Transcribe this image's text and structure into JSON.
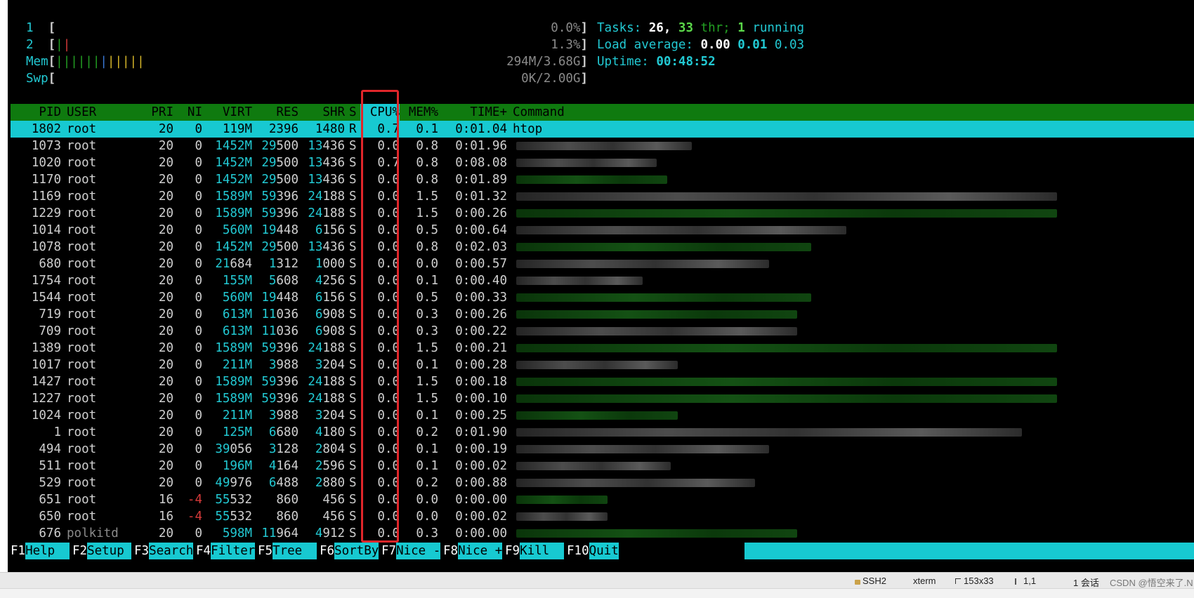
{
  "meters": {
    "cpu1": {
      "label": "1",
      "value": "0.0%"
    },
    "cpu2": {
      "label": "2",
      "value": "1.3%"
    },
    "mem": {
      "label": "Mem",
      "value": "294M/3.68G"
    },
    "swp": {
      "label": "Swp",
      "value": "0K/2.00G"
    }
  },
  "stats": {
    "tasks_label": "Tasks:",
    "tasks": "26,",
    "thr": "33",
    "thr_label": "thr;",
    "running": "1",
    "running_label": "running",
    "load_label": "Load average:",
    "load1": "0.00",
    "load5": "0.01",
    "load15": "0.03",
    "uptime_label": "Uptime:",
    "uptime": "00:48:52"
  },
  "columns": {
    "pid": "PID",
    "user": "USER",
    "pri": "PRI",
    "ni": "NI",
    "virt": "VIRT",
    "res": "RES",
    "shr": "SHR",
    "s": "S",
    "cpu": "CPU%",
    "mem": "MEM%",
    "time": "TIME+",
    "cmd": "Command"
  },
  "processes": [
    {
      "pid": "1802",
      "user": "root",
      "pri": "20",
      "ni": "0",
      "virt": "119M",
      "res": "2396",
      "shr": "1480",
      "s": "R",
      "cpu": "0.7",
      "mem": "0.1",
      "time": "0:01.04",
      "cmd": "htop"
    },
    {
      "pid": "1073",
      "user": "root",
      "pri": "20",
      "ni": "0",
      "virt": "1452M",
      "res": "29500",
      "shr": "13436",
      "s": "S",
      "cpu": "0.0",
      "mem": "0.8",
      "time": "0:01.96"
    },
    {
      "pid": "1020",
      "user": "root",
      "pri": "20",
      "ni": "0",
      "virt": "1452M",
      "res": "29500",
      "shr": "13436",
      "s": "S",
      "cpu": "0.7",
      "mem": "0.8",
      "time": "0:08.08"
    },
    {
      "pid": "1170",
      "user": "root",
      "pri": "20",
      "ni": "0",
      "virt": "1452M",
      "res": "29500",
      "shr": "13436",
      "s": "S",
      "cpu": "0.0",
      "mem": "0.8",
      "time": "0:01.89"
    },
    {
      "pid": "1169",
      "user": "root",
      "pri": "20",
      "ni": "0",
      "virt": "1589M",
      "res": "59396",
      "shr": "24188",
      "s": "S",
      "cpu": "0.0",
      "mem": "1.5",
      "time": "0:01.32"
    },
    {
      "pid": "1229",
      "user": "root",
      "pri": "20",
      "ni": "0",
      "virt": "1589M",
      "res": "59396",
      "shr": "24188",
      "s": "S",
      "cpu": "0.0",
      "mem": "1.5",
      "time": "0:00.26"
    },
    {
      "pid": "1014",
      "user": "root",
      "pri": "20",
      "ni": "0",
      "virt": "560M",
      "res": "19448",
      "shr": "6156",
      "s": "S",
      "cpu": "0.0",
      "mem": "0.5",
      "time": "0:00.64"
    },
    {
      "pid": "1078",
      "user": "root",
      "pri": "20",
      "ni": "0",
      "virt": "1452M",
      "res": "29500",
      "shr": "13436",
      "s": "S",
      "cpu": "0.0",
      "mem": "0.8",
      "time": "0:02.03"
    },
    {
      "pid": "680",
      "user": "root",
      "pri": "20",
      "ni": "0",
      "virt": "21684",
      "res": "1312",
      "shr": "1000",
      "s": "S",
      "cpu": "0.0",
      "mem": "0.0",
      "time": "0:00.57"
    },
    {
      "pid": "1754",
      "user": "root",
      "pri": "20",
      "ni": "0",
      "virt": "155M",
      "res": "5608",
      "shr": "4256",
      "s": "S",
      "cpu": "0.0",
      "mem": "0.1",
      "time": "0:00.40"
    },
    {
      "pid": "1544",
      "user": "root",
      "pri": "20",
      "ni": "0",
      "virt": "560M",
      "res": "19448",
      "shr": "6156",
      "s": "S",
      "cpu": "0.0",
      "mem": "0.5",
      "time": "0:00.33"
    },
    {
      "pid": "719",
      "user": "root",
      "pri": "20",
      "ni": "0",
      "virt": "613M",
      "res": "11036",
      "shr": "6908",
      "s": "S",
      "cpu": "0.0",
      "mem": "0.3",
      "time": "0:00.26"
    },
    {
      "pid": "709",
      "user": "root",
      "pri": "20",
      "ni": "0",
      "virt": "613M",
      "res": "11036",
      "shr": "6908",
      "s": "S",
      "cpu": "0.0",
      "mem": "0.3",
      "time": "0:00.22"
    },
    {
      "pid": "1389",
      "user": "root",
      "pri": "20",
      "ni": "0",
      "virt": "1589M",
      "res": "59396",
      "shr": "24188",
      "s": "S",
      "cpu": "0.0",
      "mem": "1.5",
      "time": "0:00.21"
    },
    {
      "pid": "1017",
      "user": "root",
      "pri": "20",
      "ni": "0",
      "virt": "211M",
      "res": "3988",
      "shr": "3204",
      "s": "S",
      "cpu": "0.0",
      "mem": "0.1",
      "time": "0:00.28"
    },
    {
      "pid": "1427",
      "user": "root",
      "pri": "20",
      "ni": "0",
      "virt": "1589M",
      "res": "59396",
      "shr": "24188",
      "s": "S",
      "cpu": "0.0",
      "mem": "1.5",
      "time": "0:00.18"
    },
    {
      "pid": "1227",
      "user": "root",
      "pri": "20",
      "ni": "0",
      "virt": "1589M",
      "res": "59396",
      "shr": "24188",
      "s": "S",
      "cpu": "0.0",
      "mem": "1.5",
      "time": "0:00.10"
    },
    {
      "pid": "1024",
      "user": "root",
      "pri": "20",
      "ni": "0",
      "virt": "211M",
      "res": "3988",
      "shr": "3204",
      "s": "S",
      "cpu": "0.0",
      "mem": "0.1",
      "time": "0:00.25"
    },
    {
      "pid": "1",
      "user": "root",
      "pri": "20",
      "ni": "0",
      "virt": "125M",
      "res": "6680",
      "shr": "4180",
      "s": "S",
      "cpu": "0.0",
      "mem": "0.2",
      "time": "0:01.90"
    },
    {
      "pid": "494",
      "user": "root",
      "pri": "20",
      "ni": "0",
      "virt": "39056",
      "res": "3128",
      "shr": "2804",
      "s": "S",
      "cpu": "0.0",
      "mem": "0.1",
      "time": "0:00.19"
    },
    {
      "pid": "511",
      "user": "root",
      "pri": "20",
      "ni": "0",
      "virt": "196M",
      "res": "4164",
      "shr": "2596",
      "s": "S",
      "cpu": "0.0",
      "mem": "0.1",
      "time": "0:00.02"
    },
    {
      "pid": "529",
      "user": "root",
      "pri": "20",
      "ni": "0",
      "virt": "49976",
      "res": "6488",
      "shr": "2880",
      "s": "S",
      "cpu": "0.0",
      "mem": "0.2",
      "time": "0:00.88"
    },
    {
      "pid": "651",
      "user": "root",
      "pri": "16",
      "ni": "-4",
      "virt": "55532",
      "res": "860",
      "shr": "456",
      "s": "S",
      "cpu": "0.0",
      "mem": "0.0",
      "time": "0:00.00"
    },
    {
      "pid": "650",
      "user": "root",
      "pri": "16",
      "ni": "-4",
      "virt": "55532",
      "res": "860",
      "shr": "456",
      "s": "S",
      "cpu": "0.0",
      "mem": "0.0",
      "time": "0:00.02"
    },
    {
      "pid": "676",
      "user": "polkitd",
      "pri": "20",
      "ni": "0",
      "virt": "598M",
      "res": "11964",
      "shr": "4912",
      "s": "S",
      "cpu": "0.0",
      "mem": "0.3",
      "time": "0:00.00"
    }
  ],
  "function_keys": [
    {
      "key": "F1",
      "label": "Help  "
    },
    {
      "key": "F2",
      "label": "Setup "
    },
    {
      "key": "F3",
      "label": "Search"
    },
    {
      "key": "F4",
      "label": "Filter"
    },
    {
      "key": "F5",
      "label": "Tree  "
    },
    {
      "key": "F6",
      "label": "SortBy"
    },
    {
      "key": "F7",
      "label": "Nice -"
    },
    {
      "key": "F8",
      "label": "Nice +"
    },
    {
      "key": "F9",
      "label": "Kill  "
    },
    {
      "key": "F10",
      "label": "Quit"
    }
  ],
  "statusbar": {
    "protocol": "SSH2",
    "terminal": "xterm",
    "size": "153x33",
    "cursor": "1,1",
    "sessions": "1 会话",
    "watermark": "CSDN @悟空来了.N"
  },
  "colors": {
    "header_bg": "#0f7a0f",
    "selected_bg": "#17c9d1",
    "highlight": "#e0262a"
  }
}
